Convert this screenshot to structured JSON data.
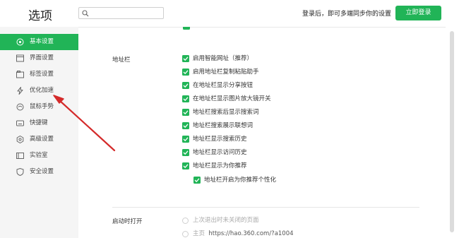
{
  "header": {
    "title": "选项",
    "search_placeholder": "",
    "login_hint": "登录后，即可多端同步你的设置",
    "login_button": "立即登录"
  },
  "sidebar": {
    "items": [
      {
        "label": "基本设置",
        "icon": "home-icon",
        "active": true
      },
      {
        "label": "界面设置",
        "icon": "window-icon",
        "active": false
      },
      {
        "label": "标签设置",
        "icon": "tab-icon",
        "active": false
      },
      {
        "label": "优化加速",
        "icon": "lightning-icon",
        "active": false
      },
      {
        "label": "鼠标手势",
        "icon": "mouse-icon",
        "active": false
      },
      {
        "label": "快捷键",
        "icon": "keyboard-icon",
        "active": false
      },
      {
        "label": "高级设置",
        "icon": "gear-icon",
        "active": false
      },
      {
        "label": "实验室",
        "icon": "lab-icon",
        "active": false
      },
      {
        "label": "安全设置",
        "icon": "shield-icon",
        "active": false
      }
    ]
  },
  "address_bar": {
    "label": "地址栏",
    "options": [
      {
        "label": "启用智能网址（推荐）",
        "checked": true
      },
      {
        "label": "启用地址栏复制粘贴助手",
        "checked": true
      },
      {
        "label": "在地址栏显示分享按钮",
        "checked": true
      },
      {
        "label": "在地址栏显示图片放大镜开关",
        "checked": true
      },
      {
        "label": "地址栏搜索后显示搜索词",
        "checked": true
      },
      {
        "label": "地址栏搜索展示联想词",
        "checked": true
      },
      {
        "label": "地址栏显示搜索历史",
        "checked": true
      },
      {
        "label": "地址栏显示访问历史",
        "checked": true
      },
      {
        "label": "地址栏显示为你推荐",
        "checked": true
      }
    ],
    "sub_option": {
      "label": "地址栏开启为你推荐个性化",
      "checked": true
    }
  },
  "startup": {
    "label": "启动时打开",
    "options": [
      {
        "label": "上次退出时未关闭的页面"
      },
      {
        "label": "主页",
        "url": "https://hao.360.com/?a1004"
      }
    ]
  },
  "colors": {
    "accent": "#21b457",
    "annotation_arrow": "#d42a2a"
  }
}
